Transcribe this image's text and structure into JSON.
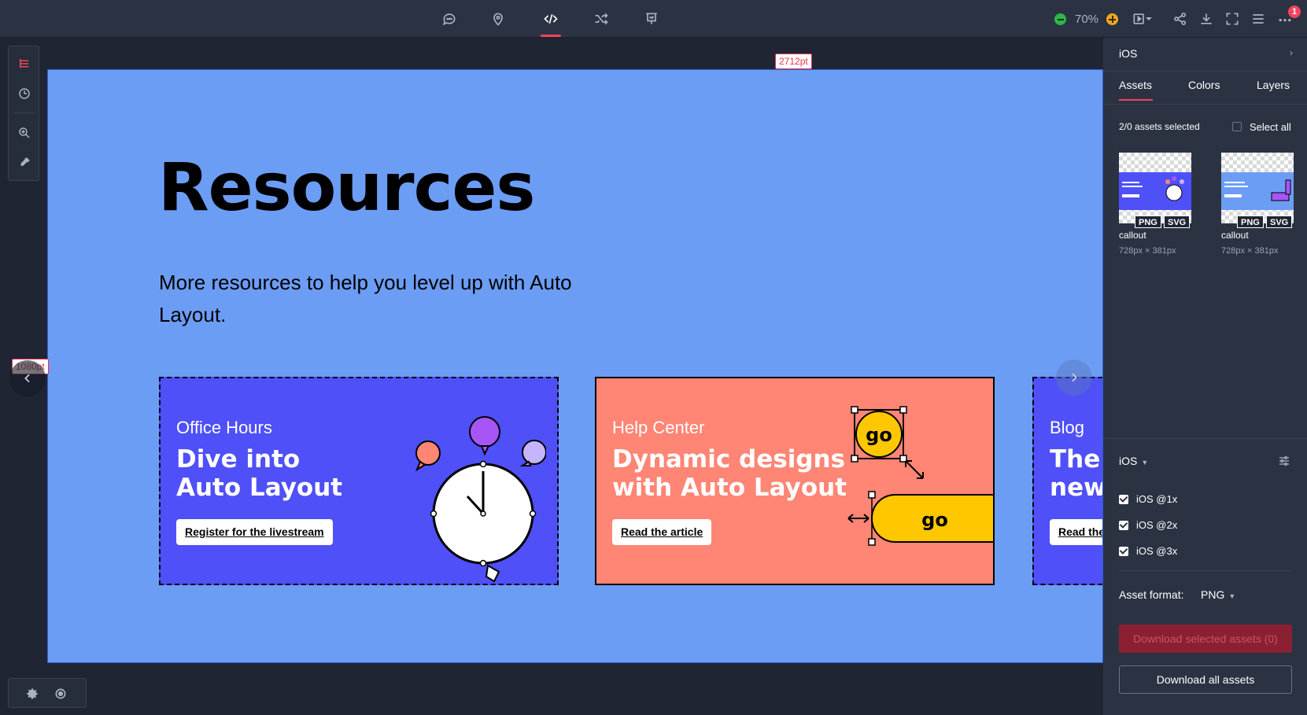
{
  "toolbar": {
    "zoom": "70%",
    "notification_count": "1"
  },
  "canvas": {
    "width_label": "2712pt",
    "height_label": "1080pt",
    "title": "Resources",
    "subtitle": "More resources to help you level up with Auto Layout.",
    "cards": [
      {
        "eyebrow": "Office Hours",
        "title_line1": "Dive into",
        "title_line2": "Auto Layout",
        "cta": "Register for the livestream",
        "bg": "#4f50f8"
      },
      {
        "eyebrow": "Help Center",
        "title_line1": "Dynamic designs",
        "title_line2": "with Auto Layout",
        "cta": "Read the article",
        "bg": "#ff8575",
        "art_text_1": "go",
        "art_text_2": "go"
      },
      {
        "eyebrow": "Blog",
        "title_line1": "The",
        "title_line2": "new",
        "cta": "Read the",
        "bg": "#4f50f8"
      }
    ]
  },
  "panel": {
    "platform": "iOS",
    "tabs": [
      "Assets",
      "Colors",
      "Layers"
    ],
    "assets_selected": "2/0 assets selected",
    "select_all": "Select all",
    "assets": [
      {
        "name": "callout",
        "dims": "728px × 381px",
        "formats": [
          "PNG",
          "SVG"
        ]
      },
      {
        "name": "callout",
        "dims": "728px × 381px",
        "formats": [
          "PNG",
          "SVG"
        ]
      }
    ],
    "export_platform": "iOS",
    "scales": [
      "iOS @1x",
      "iOS @2x",
      "iOS @3x"
    ],
    "asset_format_label": "Asset format:",
    "asset_format_value": "PNG",
    "download_selected": "Download selected assets (0)",
    "download_all": "Download all assets"
  },
  "colors": {
    "accent": "#f0455e",
    "canvas_bg": "#6c9df5",
    "panel_bg": "#2b3343"
  }
}
